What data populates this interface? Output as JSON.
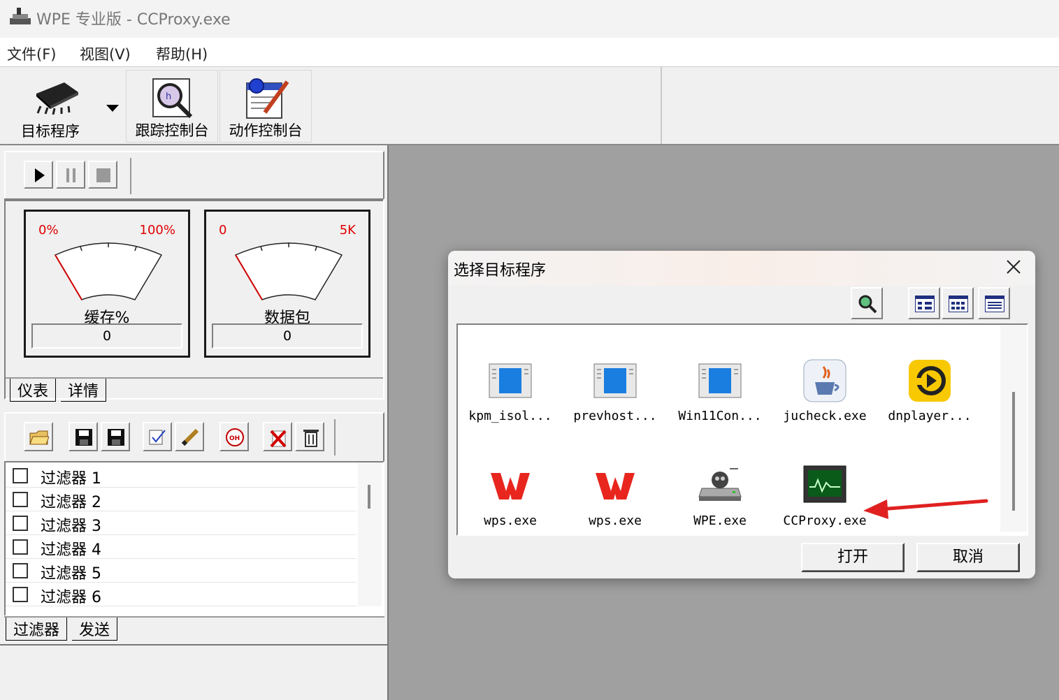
{
  "window": {
    "title": "WPE 专业版 - CCProxy.exe"
  },
  "menu": [
    "文件(F)",
    "视图(V)",
    "帮助(H)"
  ],
  "toolbar": {
    "target": "目标程序",
    "trace": "跟踪控制台",
    "action": "动作控制台"
  },
  "gauges": [
    {
      "name": "缓存%",
      "lo": "0%",
      "hi": "100%",
      "value": "0"
    },
    {
      "name": "数据包",
      "lo": "0",
      "hi": "5K",
      "value": "0"
    }
  ],
  "meter_tabs": [
    "仪表",
    "详情"
  ],
  "filters": [
    "过滤器 1",
    "过滤器 2",
    "过滤器 3",
    "过滤器 4",
    "过滤器 5",
    "过滤器 6"
  ],
  "filter_tabs": [
    "过滤器",
    "发送"
  ],
  "dialog": {
    "title": "选择目标程序",
    "open": "打开",
    "cancel": "取消",
    "processes": [
      "kpm_isol...",
      "prevhost...",
      "Win11Con...",
      "jucheck.exe",
      "dnplayer...",
      "wps.exe",
      "wps.exe",
      "WPE.exe",
      "CCProxy.exe"
    ]
  }
}
